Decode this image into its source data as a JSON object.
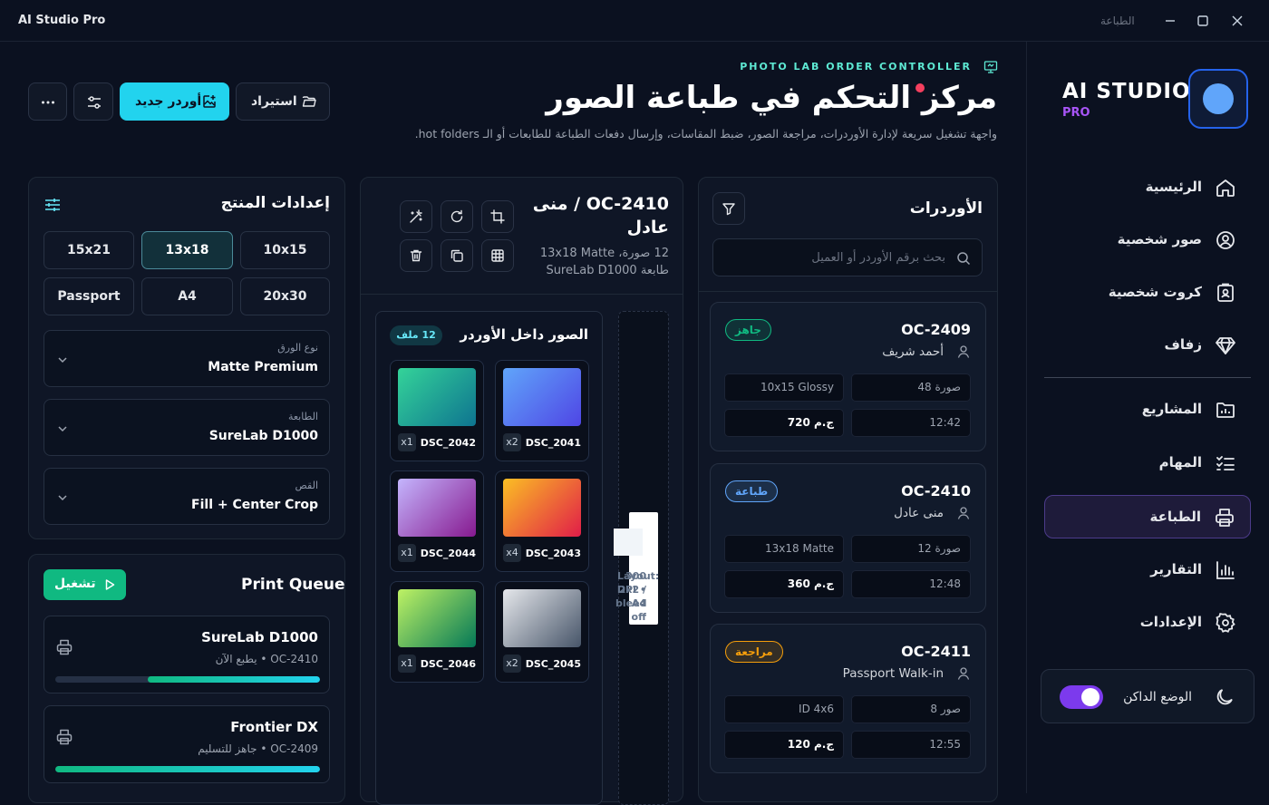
{
  "window": {
    "title": "AI Studio Pro",
    "active_section": "الطباعة"
  },
  "sidebar": {
    "brand": "AI STUDIO",
    "brand_sub": "PRO",
    "items": [
      {
        "label": "الرئيسية",
        "icon": "home-icon"
      },
      {
        "label": "صور شخصية",
        "icon": "user-circle-icon"
      },
      {
        "label": "كروت شخصية",
        "icon": "id-card-icon"
      },
      {
        "label": "زفاف",
        "icon": "diamond-icon"
      },
      {
        "label": "المشاريع",
        "icon": "folder-chart-icon"
      },
      {
        "label": "المهام",
        "icon": "task-list-icon"
      },
      {
        "label": "الطباعة",
        "icon": "printer-icon",
        "active": true
      },
      {
        "label": "التقارير",
        "icon": "bar-chart-icon"
      },
      {
        "label": "الإعدادات",
        "icon": "gear-icon"
      }
    ],
    "dark_mode": {
      "label": "الوضع الداكن",
      "enabled": true
    }
  },
  "header": {
    "eyebrow": "PHOTO LAB ORDER CONTROLLER",
    "title": "مركز التحكم في طباعة الصور",
    "subtitle": "واجهة تشغيل سريعة لإدارة الأوردرات، مراجعة الصور، ضبط المقاسات، وإرسال دفعات الطباعة للطابعات أو الـ hot folders.",
    "import_label": "استيراد",
    "new_order_label": "أوردر جديد"
  },
  "product_settings": {
    "title": "إعدادات المنتج",
    "sizes": [
      "15x21",
      "13x18",
      "10x15",
      "Passport",
      "A4",
      "20x30"
    ],
    "selected_size": "13x18",
    "paper": {
      "label": "نوع الورق",
      "value": "Matte Premium"
    },
    "printer": {
      "label": "الطابعة",
      "value": "SureLab D1000"
    },
    "crop": {
      "label": "القص",
      "value": "Fill + Center Crop"
    }
  },
  "print_queue": {
    "title": "Print Queue",
    "run_label": "تشغيل",
    "items": [
      {
        "name": "SureLab D1000",
        "status": "OC-2410 • يطبع الآن",
        "progress": 0.65
      },
      {
        "name": "Frontier DX",
        "status": "OC-2409 • جاهز للتسليم",
        "progress": 1.0
      }
    ]
  },
  "order_detail": {
    "title_line1": "OC-2410 / منى",
    "title_line2": "عادل",
    "meta_line1": "12 صورة، 13x18 Matte",
    "meta_line2": "طابعة SureLab D1000",
    "photos_title": "الصور داخل الأوردر",
    "files_badge": "12 ملف",
    "photos": [
      {
        "name": "DSC_2041",
        "qty": "x2",
        "c1": "#60a5fa",
        "c2": "#4f46e5"
      },
      {
        "name": "DSC_2042",
        "qty": "x1",
        "c1": "#34d399",
        "c2": "#0e7490"
      },
      {
        "name": "DSC_2043",
        "qty": "x4",
        "c1": "#fbbf24",
        "c2": "#e11d48"
      },
      {
        "name": "DSC_2044",
        "qty": "x1",
        "c1": "#c4b5fd",
        "c2": "#86198f"
      },
      {
        "name": "DSC_2045",
        "qty": "x2",
        "c1": "#e5e7eb",
        "c2": "#475569"
      },
      {
        "name": "DSC_2046",
        "qty": "x1",
        "c1": "#bef264",
        "c2": "#047857"
      }
    ],
    "preview_lines": [
      "Layout:",
      "2x2 /",
      "A4"
    ],
    "preview_info": [
      "300 DPI •",
      "bleed",
      "off"
    ]
  },
  "orders": {
    "title": "الأوردرات",
    "search_placeholder": "بحث برقم الأوردر أو العميل",
    "items": [
      {
        "id": "OC-2409",
        "customer": "أحمد شريف",
        "status": "جاهز",
        "status_color": "#10b981",
        "photos": "48 صورة",
        "size": "10x15 Glossy",
        "time": "12:42",
        "price": "720 ج.م"
      },
      {
        "id": "OC-2410",
        "customer": "منى عادل",
        "status": "طباعة",
        "status_color": "#60a5fa",
        "photos": "12 صورة",
        "size": "13x18 Matte",
        "time": "12:48",
        "price": "360 ج.م"
      },
      {
        "id": "OC-2411",
        "customer": "Passport Walk-in",
        "status": "مراجعة",
        "status_color": "#f59e0b",
        "photos": "8 صور",
        "size": "ID 4x6",
        "time": "12:55",
        "price": "120 ج.م"
      }
    ]
  }
}
